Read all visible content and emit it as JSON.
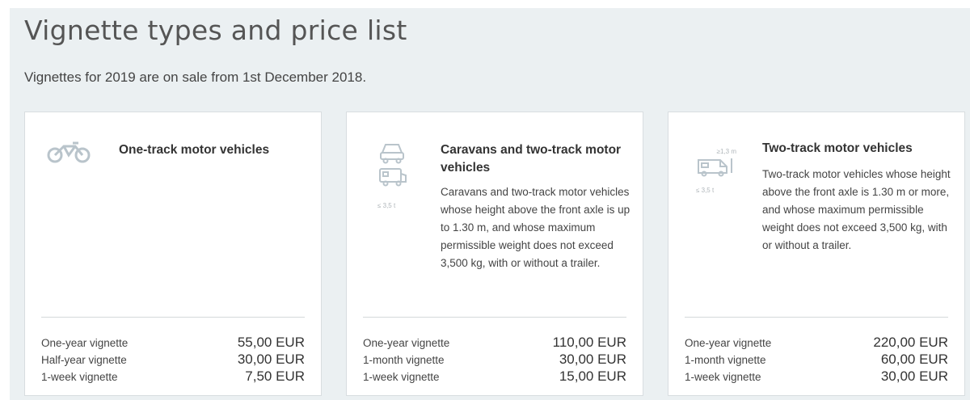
{
  "page": {
    "title": "Vignette types and price list",
    "subtitle": "Vignettes for 2019 are on sale from 1st December 2018."
  },
  "cards": [
    {
      "icon": "motorcycle-icon",
      "title": "One-track motor vehicles",
      "description": "",
      "prices": [
        {
          "label": "One-year vignette",
          "value": "55,00 EUR"
        },
        {
          "label": "Half-year vignette",
          "value": "30,00 EUR"
        },
        {
          "label": "1-week vignette",
          "value": "7,50 EUR"
        }
      ]
    },
    {
      "icon": "car-caravan-icon",
      "icon_note": "≤ 3,5 t",
      "title": "Caravans and two-track motor vehicles",
      "description": "Caravans and two-track motor vehicles whose height above the front axle is up to 1.30 m, and whose maximum permissible weight does not exceed 3,500 kg, with or without a trailer.",
      "prices": [
        {
          "label": "One-year vignette",
          "value": "110,00 EUR"
        },
        {
          "label": "1-month vignette",
          "value": "30,00 EUR"
        },
        {
          "label": "1-week vignette",
          "value": "15,00 EUR"
        }
      ]
    },
    {
      "icon": "van-icon",
      "icon_note": "≤ 3,5 t",
      "icon_height_note": "≥1,3 m",
      "title": "Two-track motor vehicles",
      "description": "Two-track motor vehicles whose height above the front axle is 1.30 m or more, and whose maximum permissible weight does not exceed 3,500 kg, with or without a trailer.",
      "prices": [
        {
          "label": "One-year vignette",
          "value": "220,00 EUR"
        },
        {
          "label": "1-month vignette",
          "value": "60,00 EUR"
        },
        {
          "label": "1-week vignette",
          "value": "30,00 EUR"
        }
      ]
    }
  ],
  "colors": {
    "panel_bg": "#ebf0f2",
    "card_bg": "#ffffff",
    "icon": "#b9c4cb"
  }
}
